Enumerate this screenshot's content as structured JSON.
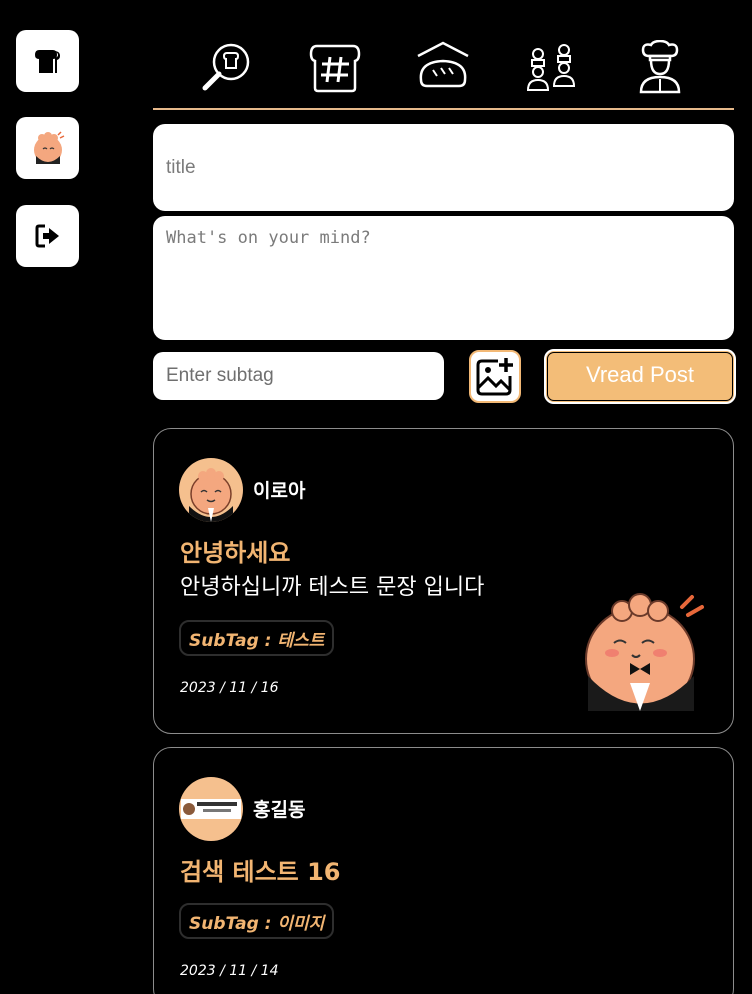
{
  "sidebar": {
    "items": [
      {
        "name": "home",
        "icon": "bread-icon"
      },
      {
        "name": "profile",
        "icon": "avatar-bread-icon"
      },
      {
        "name": "logout",
        "icon": "logout-icon"
      }
    ]
  },
  "topnav": {
    "icons": [
      "search-bread-icon",
      "hashtag-bread-icon",
      "bread-loaf-icon",
      "chefs-group-icon",
      "chef-icon"
    ]
  },
  "compose": {
    "title_placeholder": "title",
    "body_placeholder": "What's on your mind?",
    "subtag_placeholder": "Enter subtag",
    "image_button_icon": "add-image-icon",
    "post_button_label": "Vread Post"
  },
  "posts": [
    {
      "author": "이로아",
      "title": "안녕하세요",
      "text": "안녕하십니까 테스트 문장 입니다",
      "subtag": "SubTag : 테스트",
      "date": "2023 / 11 / 16",
      "has_image": true
    },
    {
      "author": "홍길동",
      "title": "검색 테스트 16",
      "text": "",
      "subtag": "SubTag : 이미지",
      "date": "2023 / 11 / 14",
      "has_image": false
    }
  ],
  "colors": {
    "accent": "#f3bd78",
    "background": "#000000",
    "divider": "#e6b98b"
  }
}
